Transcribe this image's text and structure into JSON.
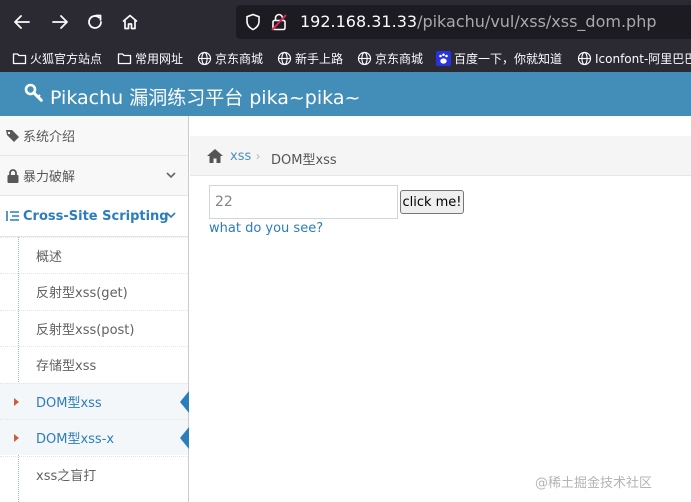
{
  "browser": {
    "url_host": "192.168.31.33",
    "url_path": "/pikachu/vul/xss/xss_dom.php",
    "bookmarks": [
      {
        "label": "火狐官方站点",
        "icon": "folder-icon"
      },
      {
        "label": "常用网址",
        "icon": "folder-icon"
      },
      {
        "label": "京东商城",
        "icon": "globe-icon"
      },
      {
        "label": "新手上路",
        "icon": "globe-icon"
      },
      {
        "label": "京东商城",
        "icon": "globe-icon"
      },
      {
        "label": "百度一下，你就知道",
        "icon": "baidu-paw-icon"
      },
      {
        "label": "Iconfont-阿里巴巴",
        "icon": "globe-icon"
      }
    ]
  },
  "header": {
    "title": "Pikachu 漏洞练习平台 pika~pika~"
  },
  "sidebar": {
    "items": [
      {
        "label": "系统介绍",
        "icon": "tags-icon"
      },
      {
        "label": "暴力破解",
        "icon": "lock-icon"
      },
      {
        "label": "Cross-Site Scripting",
        "icon": "list-indent-icon"
      }
    ],
    "submenu": [
      {
        "label": "概述"
      },
      {
        "label": "反射型xss(get)"
      },
      {
        "label": "反射型xss(post)"
      },
      {
        "label": "存储型xss"
      },
      {
        "label": "DOM型xss"
      },
      {
        "label": "DOM型xss-x"
      },
      {
        "label": "xss之盲打"
      }
    ]
  },
  "breadcrumb": {
    "parent": "xss",
    "current": "DOM型xss"
  },
  "form": {
    "input_value": "22",
    "button_label": "click me!",
    "link_text": "what do you see?"
  },
  "watermark": "@稀土掘金技术社区",
  "colors": {
    "header_bg": "#438eb9",
    "accent": "#2b7dbc",
    "browser_bg": "#2b2a33"
  }
}
